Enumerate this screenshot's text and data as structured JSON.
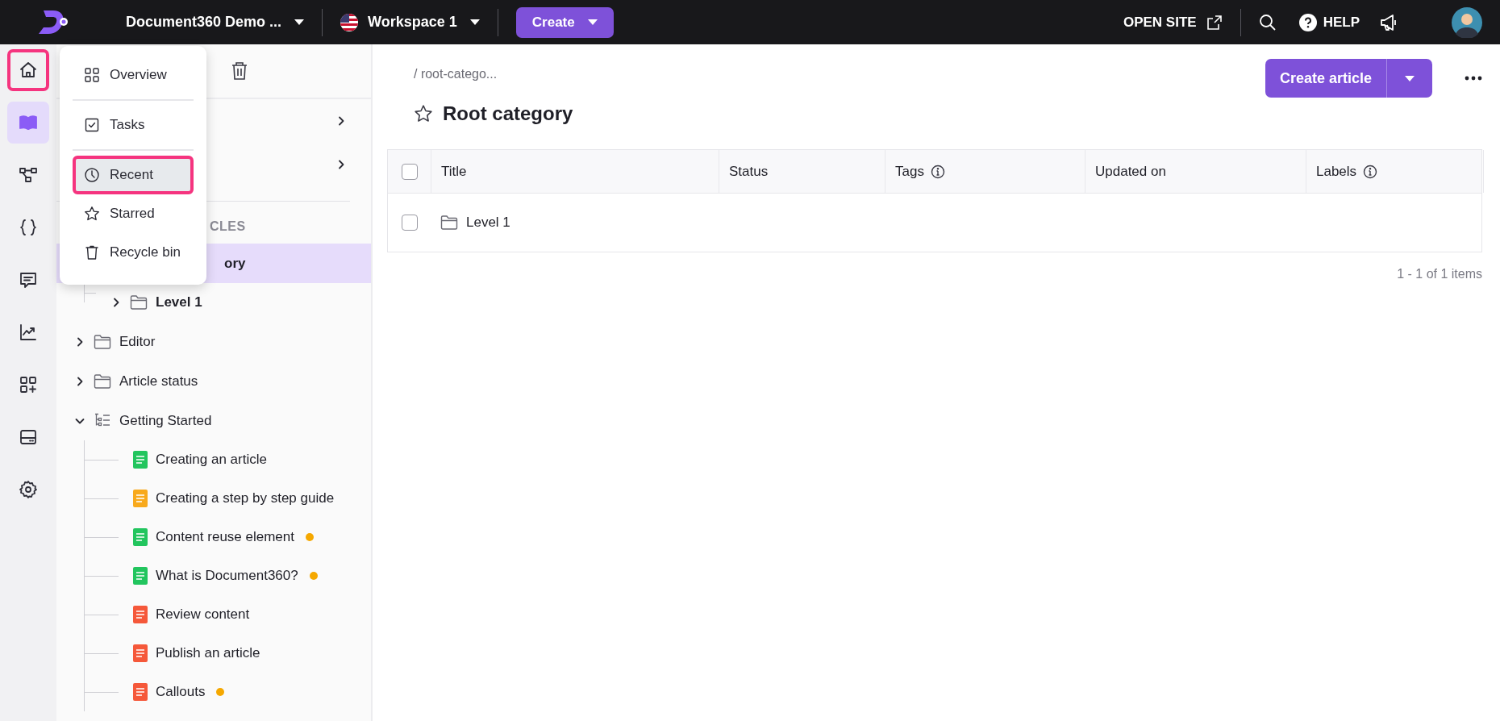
{
  "topbar": {
    "project": "Document360 Demo ...",
    "workspace": "Workspace 1",
    "create": "Create",
    "open_site": "OPEN SITE",
    "help": "HELP"
  },
  "rail": [
    {
      "kind": "home",
      "selected": false,
      "highlighted": true
    },
    {
      "kind": "docs",
      "selected": true,
      "highlighted": false
    },
    {
      "kind": "flow",
      "selected": false,
      "highlighted": false
    },
    {
      "kind": "code",
      "selected": false,
      "highlighted": false
    },
    {
      "kind": "feedback",
      "selected": false,
      "highlighted": false
    },
    {
      "kind": "analytics",
      "selected": false,
      "highlighted": false
    },
    {
      "kind": "apps",
      "selected": false,
      "highlighted": false
    },
    {
      "kind": "widget",
      "selected": false,
      "highlighted": false
    },
    {
      "kind": "settings",
      "selected": false,
      "highlighted": false
    }
  ],
  "home_menu": [
    {
      "kind": "overview",
      "label": "Overview",
      "highlighted": false
    },
    {
      "kind": "tasks",
      "label": "Tasks",
      "highlighted": false
    },
    {
      "kind": "recent",
      "label": "Recent",
      "highlighted": true
    },
    {
      "kind": "starred",
      "label": "Starred",
      "highlighted": false
    },
    {
      "kind": "recycle",
      "label": "Recycle bin",
      "highlighted": false
    }
  ],
  "sidebar": {
    "sections": [
      {
        "expanded": false
      },
      {
        "expanded": false
      }
    ],
    "heading": "CLES",
    "tree": [
      {
        "label": "ory",
        "kind": "root",
        "selected": true,
        "children": [
          {
            "label": "Level 1",
            "kind": "folder",
            "expanded": false,
            "selected": false
          }
        ]
      },
      {
        "label": "Editor",
        "kind": "folder",
        "expanded": false,
        "selected": false
      },
      {
        "label": "Article status",
        "kind": "folder",
        "expanded": false,
        "selected": false
      },
      {
        "label": "Getting Started",
        "kind": "index",
        "expanded": true,
        "selected": false,
        "children": [
          {
            "label": "Creating an article",
            "kind": "article",
            "color": "#22c55e",
            "pending": false
          },
          {
            "label": "Creating a step by step guide",
            "kind": "article",
            "color": "#f8a91c",
            "pending": false
          },
          {
            "label": "Content reuse element",
            "kind": "article",
            "color": "#22c55e",
            "pending": true
          },
          {
            "label": "What is Document360?",
            "kind": "article",
            "color": "#22c55e",
            "pending": true
          },
          {
            "label": "Review content",
            "kind": "article",
            "color": "#f5583a",
            "pending": false
          },
          {
            "label": "Publish an article",
            "kind": "article",
            "color": "#f5583a",
            "pending": false
          },
          {
            "label": "Callouts",
            "kind": "article",
            "color": "#f5583a",
            "pending": true
          }
        ]
      }
    ]
  },
  "main": {
    "breadcrumb": "/ root-catego...",
    "title": "Root category",
    "starred": false,
    "create_article": "Create article",
    "table": {
      "columns": [
        {
          "label": "Title",
          "info": false
        },
        {
          "label": "Status",
          "info": false
        },
        {
          "label": "Tags",
          "info": true
        },
        {
          "label": "Updated on",
          "info": false
        },
        {
          "label": "Labels",
          "info": true
        }
      ],
      "rows": [
        {
          "kind": "folder",
          "title": "Level 1",
          "checked": false
        }
      ],
      "header_checked": false
    },
    "pagination": "1 - 1 of 1 items"
  }
}
